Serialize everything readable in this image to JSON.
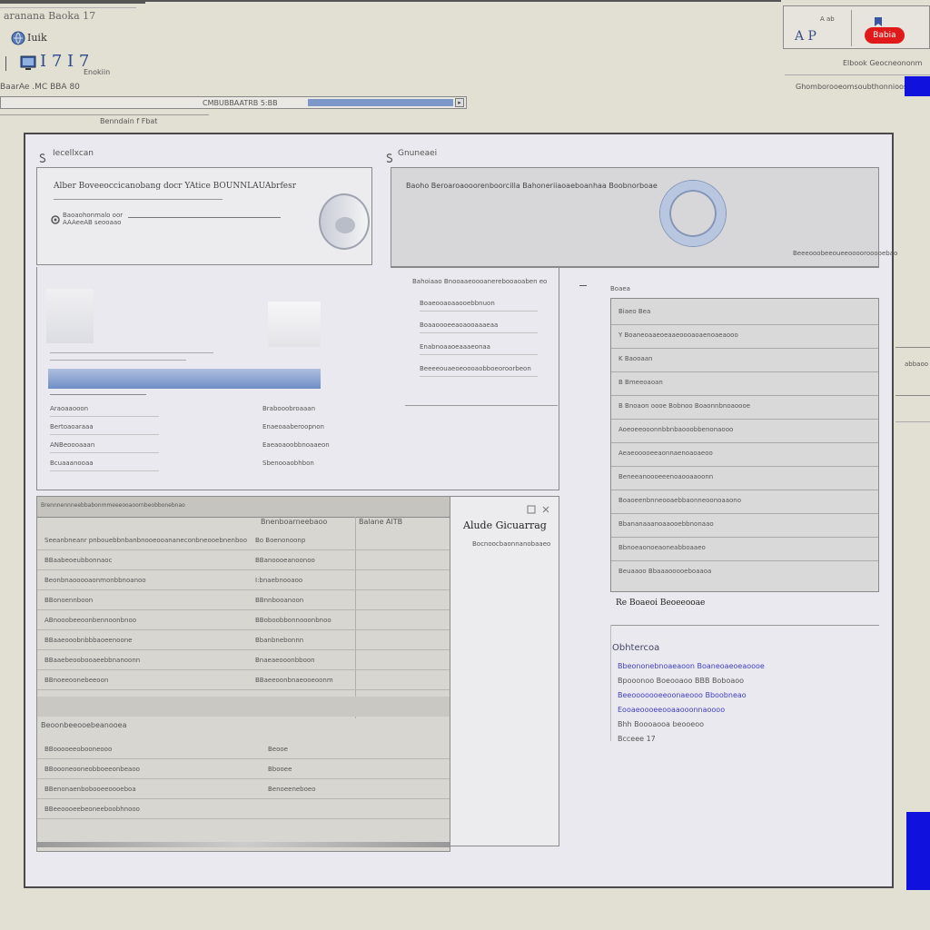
{
  "window": {
    "title": "aranana Baoka 17",
    "toolbar_label": "Iuik",
    "toolbar2_label": "I 7 I 7",
    "toolbar2_caption": "Enokiin",
    "status_left": "BaarAe  .MC  BBA 80",
    "progress_label": "CMBUBBAATRB  5:BB",
    "progress_value": 0.35,
    "subtitle": "Benndain  f  Fbat"
  },
  "top_right": {
    "label1": "A ab",
    "label2": "A P",
    "badge": "Babia",
    "caption": "Elbook  Geocneononm",
    "heading": "Ghomborooeomsoubthonnioossoe",
    "accent": "#1111dd",
    "badge_color": "#e01a1a"
  },
  "side_note": "abbaoo",
  "dialog": {
    "section_left": "Iecellxcan",
    "section_right": "Gnuneaei",
    "card_left": {
      "title": "Alber  Boveeoccicanobang docr  YAtice  BOUNNLAUAbrfesr",
      "line1": "Baoaohonmalo oor",
      "line2": "AAAeeAB seooaao"
    },
    "card_right": {
      "title": "Baoho Beroaroaooorenboorcilla Bahoneriiaoaeboanhaa  Boobnorboae",
      "caption": "Beeeooobeeoueeoooorooooebao"
    },
    "left_list": {
      "rows": [
        {
          "a": "Araoaaooon",
          "b": "Brabooobroaaan"
        },
        {
          "a": "Bertoaoaraaa",
          "b": "Enaeoaaberoopnon"
        },
        {
          "a": "ANBeoooaaan",
          "b": "Eaeaoaoobbnoaaeon"
        },
        {
          "a": "Bcuaaanooaa",
          "b": "Sbenooaobhbon"
        }
      ]
    },
    "center_box": {
      "title": "Bahoiaao  Bnooaaeoooanerebooaoaben  eo",
      "lines": [
        "Boaeooaoaaooebbnuon",
        "Boaaoooeeaoaooaaaeaa",
        "Enabnoaaoeaaaeonaa",
        "Beeeeouaeoeoooaobboeoroorbeon"
      ]
    },
    "table": {
      "header": "Brennnennneebbabonmmeeeooaoornbeobbonebnao",
      "col_headers": [
        "Bnenboarneebaoo",
        "Balane  AlTB"
      ],
      "rows": [
        {
          "c1": "Seeanbneanr  pnbouebbnbanbnooeooananeconbneooebnenboo",
          "c2": "Bo  Boenonoonp"
        },
        {
          "c1": "BBaabeoeubbonnaoc",
          "c2": "BBanoooeanoonoo"
        },
        {
          "c1": "Beonbnaooooaonmonbbnoanoo",
          "c2": "I:bnaebnooaoo"
        },
        {
          "c1": "BBonoennboon",
          "c2": "BBnnbooanoon"
        },
        {
          "c1": "ABnooobeeoonbennoonbnoo",
          "c2": "BBoboobbonnooonbnoo"
        },
        {
          "c1": "BBaaeooobnbbbaoeenoone",
          "c2": "Bbanbnebonnn"
        },
        {
          "c1": "BBaaebeoobooaeebbnanoonn",
          "c2": "Bnaeaeooonbboon"
        },
        {
          "c1": "BBnoeeoonebeeoon",
          "c2": "BBaeeoonbnaeooeoonm"
        }
      ],
      "group_label": "Beoonbeeooebeanooea",
      "group_rows": [
        {
          "c1": "BBooooeeobooneooo",
          "c2": "Beooe"
        },
        {
          "c1": "BBoooneooneobboeeonbeaoo",
          "c2": "Bbooee"
        },
        {
          "c1": "BBenonaenbobooeeoooeboa",
          "c2": "Benoeeneboeo"
        },
        {
          "c1": "BBeeoooeebeoneeboobhnooo",
          "c2": ""
        }
      ],
      "side_title": "Alude Gicuarrag",
      "side_caption": "Bocnoocbaonnanobaaeo"
    },
    "right_list": {
      "header_label": "Boaea",
      "items": [
        "Biaeo  Bea",
        "Y  Boaneoaaeoeaaeoooaoaenoaeaooo",
        "K  Baooaan",
        "B  Bmeeoaoan",
        "B  Bnoaon  oooe  Bobnoo  Boaonnbnoaoooe",
        "Aoeoeeooonnbbnbaooobbenonaooo",
        "Aeaeooooeeaonnaenoaoaeoo",
        "Beneeanoooeeenoaooaaoonn",
        "Boaoeenbnneooaebbaonneoonoaaono",
        "Bbananaaanoaaooebbnonaao",
        "Bbnoeaonoeaoneabboaaeo",
        "Beuaaoo  Bbaaaooooeboaaoa"
      ],
      "footer": "Re  Boaeoi  Beoeeooae"
    },
    "links": {
      "title": "Obhtercoa",
      "lines": [
        {
          "text": "Bbeononebnoaeaoon  Boaneoaeoeaoooe",
          "link": true
        },
        {
          "text": "Bpooonoo  Boeooaoo  BBB  Boboaoo",
          "link": false
        },
        {
          "text": "Beeooooooeeoonaeooo  Bboobneao",
          "link": true
        },
        {
          "text": "Eooaeoooeeooaaooonnaoooo",
          "link": true
        },
        {
          "text": "Bhh  Boooaooa  beooeoo",
          "link": false
        },
        {
          "text": "Bcceee 17",
          "link": false
        }
      ]
    }
  }
}
